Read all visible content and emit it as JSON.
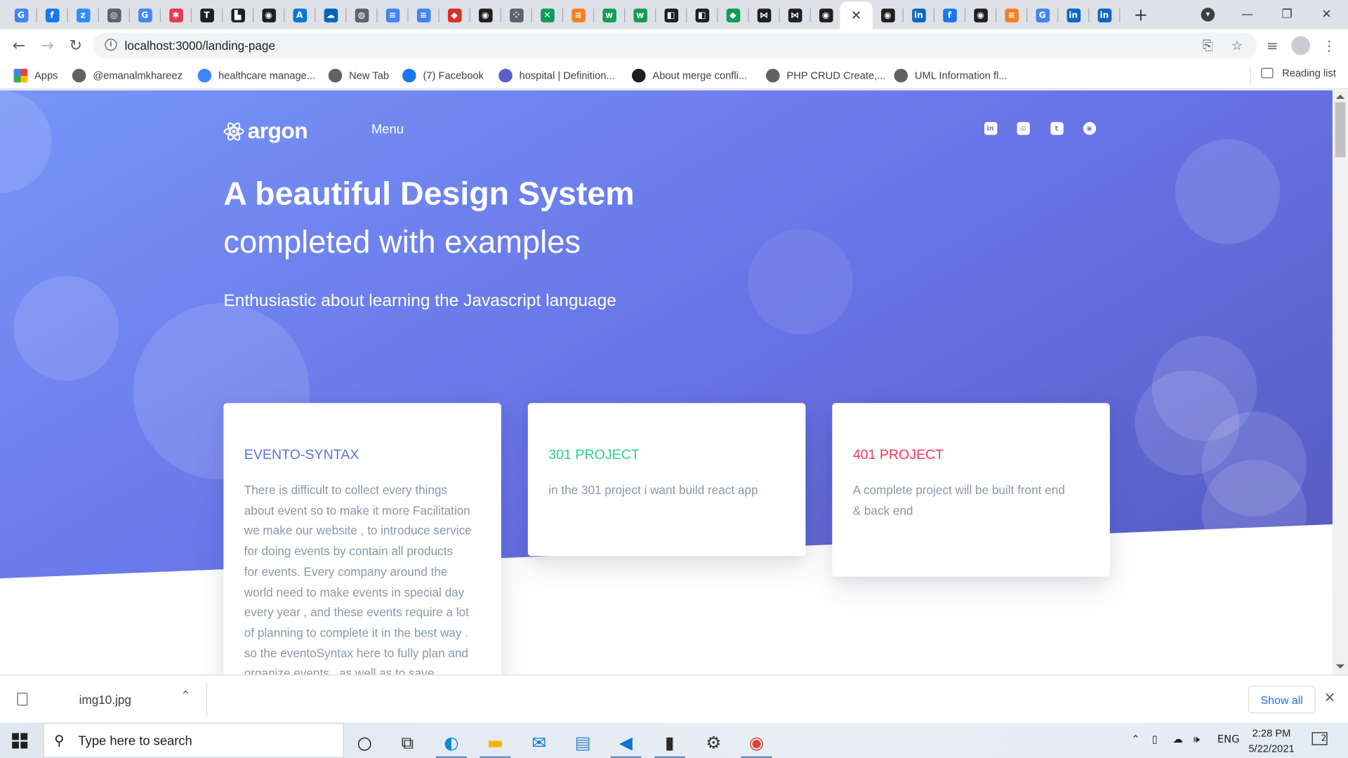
{
  "browser": {
    "tabs": [
      {
        "icon": "google-icon",
        "color": "#4285f4",
        "glyph": "G"
      },
      {
        "icon": "facebook-icon",
        "color": "#1877f2",
        "glyph": "f"
      },
      {
        "icon": "zoom-icon",
        "color": "#2d8cff",
        "glyph": "z"
      },
      {
        "icon": "clock-icon",
        "color": "#5f6368",
        "glyph": "◎"
      },
      {
        "icon": "translate-icon",
        "color": "#4285f4",
        "glyph": "G"
      },
      {
        "icon": "asana-icon",
        "color": "#e8384f",
        "glyph": "✱"
      },
      {
        "icon": "trello-icon",
        "color": "#1f1f1f",
        "glyph": "T"
      },
      {
        "icon": "zapier-icon",
        "color": "#1f1f1f",
        "glyph": "▙"
      },
      {
        "icon": "github-icon",
        "color": "#1f1f1f",
        "glyph": "◉"
      },
      {
        "icon": "azure-icon",
        "color": "#0078d4",
        "glyph": "A"
      },
      {
        "icon": "onedrive-icon",
        "color": "#0364b8",
        "glyph": "☁"
      },
      {
        "icon": "globe-icon",
        "color": "#5f6368",
        "glyph": "◍"
      },
      {
        "icon": "docs-icon",
        "color": "#4285f4",
        "glyph": "≡"
      },
      {
        "icon": "docs-icon",
        "color": "#4285f4",
        "glyph": "≡"
      },
      {
        "icon": "shield-icon",
        "color": "#d93025",
        "glyph": "◆"
      },
      {
        "icon": "github-icon",
        "color": "#1f1f1f",
        "glyph": "◉"
      },
      {
        "icon": "dots-icon",
        "color": "#5f6368",
        "glyph": "⁘"
      },
      {
        "icon": "chart-icon",
        "color": "#0f9d58",
        "glyph": "✕"
      },
      {
        "icon": "stackoverflow-icon",
        "color": "#f48024",
        "glyph": "≡"
      },
      {
        "icon": "w-icon",
        "color": "#0f9d58",
        "glyph": "w"
      },
      {
        "icon": "w-icon",
        "color": "#0f9d58",
        "glyph": "w"
      },
      {
        "icon": "notion-icon",
        "color": "#1f1f1f",
        "glyph": "◧"
      },
      {
        "icon": "notion-icon",
        "color": "#1f1f1f",
        "glyph": "◧"
      },
      {
        "icon": "diamond-icon",
        "color": "#0f9d58",
        "glyph": "◆"
      },
      {
        "icon": "bow-icon",
        "color": "#1f1f1f",
        "glyph": "⋈"
      },
      {
        "icon": "bow-icon",
        "color": "#1f1f1f",
        "glyph": "⋈"
      },
      {
        "icon": "github-icon",
        "color": "#1f1f1f",
        "glyph": "◉"
      }
    ],
    "active_tab_close": "✕",
    "tabs_after": [
      {
        "icon": "github-icon",
        "color": "#1f1f1f",
        "glyph": "◉"
      },
      {
        "icon": "linkedin-icon",
        "color": "#0a66c2",
        "glyph": "in"
      },
      {
        "icon": "facebook-icon",
        "color": "#1877f2",
        "glyph": "f"
      },
      {
        "icon": "github-icon",
        "color": "#1f1f1f",
        "glyph": "◉"
      },
      {
        "icon": "stackoverflow-icon",
        "color": "#f48024",
        "glyph": "≡"
      },
      {
        "icon": "google-icon",
        "color": "#4285f4",
        "glyph": "G"
      },
      {
        "icon": "linkedin-icon",
        "color": "#0a66c2",
        "glyph": "in"
      },
      {
        "icon": "linkedin-icon",
        "color": "#0a66c2",
        "glyph": "in"
      }
    ],
    "new_tab": "+",
    "url": "localhost:3000/landing-page",
    "bookmarks": [
      {
        "label": "Apps",
        "icon": "apps-grid-icon",
        "color": "#ea4335"
      },
      {
        "label": "@emanalmkhareez",
        "icon": "globe-icon",
        "color": "#5f6368"
      },
      {
        "label": "healthcare manage...",
        "icon": "google-icon",
        "color": "#4285f4"
      },
      {
        "label": "New Tab",
        "icon": "globe-icon",
        "color": "#5f6368"
      },
      {
        "label": "(7) Facebook",
        "icon": "facebook-icon",
        "color": "#1877f2"
      },
      {
        "label": "hospital | Definition...",
        "icon": "dictionary-icon",
        "color": "#5b5fc7"
      },
      {
        "label": "About merge confli...",
        "icon": "github-icon",
        "color": "#1f1f1f"
      },
      {
        "label": "PHP CRUD Create,...",
        "icon": "globe-icon",
        "color": "#5f6368"
      },
      {
        "label": "UML Information fl...",
        "icon": "diagram-icon",
        "color": "#5f6368"
      }
    ],
    "reading_list": "Reading list"
  },
  "page": {
    "brand": "argon",
    "menu": "Menu",
    "social": [
      {
        "name": "linkedin-icon",
        "glyph": "in"
      },
      {
        "name": "instagram-icon",
        "glyph": "◎"
      },
      {
        "name": "twitter-icon",
        "glyph": "t"
      },
      {
        "name": "github-icon",
        "glyph": "◉"
      }
    ],
    "headline": "A beautiful Design System",
    "subheadline": "completed with examples",
    "lead": "Enthusiastic about learning the Javascript language",
    "cards": [
      {
        "title": "EVENTO-SYNTAX",
        "color": "#5e72e4",
        "text_lines": [
          "There is difficult to collect every things",
          "about event so to make it more Facilitation",
          "we make our website , to introduce service",
          "for doing events by contain all products",
          "for events. Every company around the",
          "world need to make events in special day",
          "every year , and these events require a lot",
          "of planning to complete it in the best way .",
          "so the eventoSyntax here to fully plan and",
          "organize events , as well as to save"
        ]
      },
      {
        "title": "301 PROJECT",
        "color": "#2dce89",
        "text_lines": [
          "in the 301 project i want build react app"
        ]
      },
      {
        "title": "401 PROJECT",
        "color": "#f5365c",
        "text_lines": [
          "A complete project will be built front end",
          "& back end"
        ]
      }
    ],
    "colors": {
      "gradient_start": "#7795f8",
      "gradient_end": "#555abf",
      "muted_text": "#8898aa"
    }
  },
  "downloads": {
    "file": "img10.jpg",
    "show_all": "Show all"
  },
  "taskbar": {
    "search_placeholder": "Type here to search",
    "apps": [
      "cortana-icon",
      "task-view-icon",
      "edge-icon",
      "file-explorer-icon",
      "mail-icon",
      "network-app-icon",
      "vscode-icon",
      "terminal-icon",
      "settings-icon",
      "chrome-icon"
    ],
    "language": "ENG",
    "time": "2:28 PM",
    "date": "5/22/2021",
    "notification_count": "2"
  }
}
